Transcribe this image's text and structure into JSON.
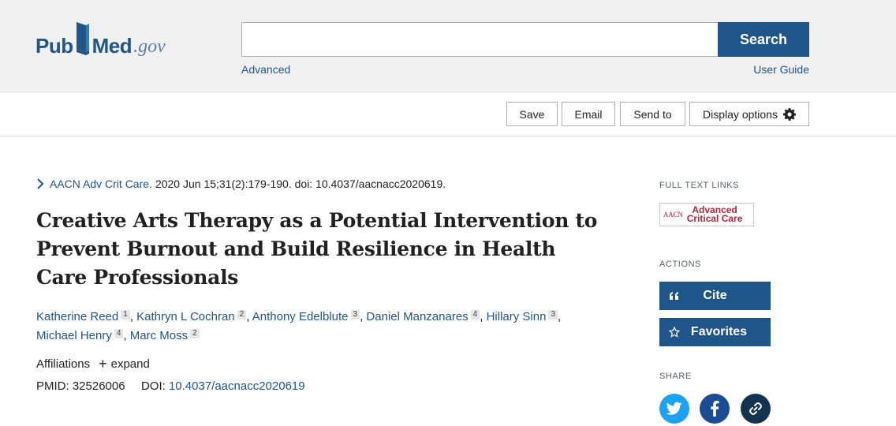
{
  "logo": {
    "pub": "Pub",
    "med": "Med",
    "gov": ".gov"
  },
  "search": {
    "value": "",
    "placeholder": "",
    "button_label": "Search",
    "advanced_label": "Advanced",
    "user_guide_label": "User Guide"
  },
  "toolbar": {
    "save_label": "Save",
    "email_label": "Email",
    "send_to_label": "Send to",
    "display_options_label": "Display options"
  },
  "article": {
    "journal": "AACN Adv Crit Care.",
    "citation_rest": "2020 Jun 15;31(2):179-190. doi: 10.4037/aacnacc2020619.",
    "title": "Creative Arts Therapy as a Potential Intervention to Prevent Burnout and Build Resilience in Health Care Professionals",
    "authors": [
      {
        "name": "Katherine Reed",
        "aff": "1"
      },
      {
        "name": "Kathryn L Cochran",
        "aff": "2"
      },
      {
        "name": "Anthony Edelblute",
        "aff": "3"
      },
      {
        "name": "Daniel Manzanares",
        "aff": "4"
      },
      {
        "name": "Hillary Sinn",
        "aff": "3"
      },
      {
        "name": "Michael Henry",
        "aff": "4"
      },
      {
        "name": "Marc Moss",
        "aff": "2"
      }
    ],
    "affiliations_label": "Affiliations",
    "expand_label": "expand",
    "pmid_label": "PMID:",
    "pmid": "32526006",
    "doi_label": "DOI:",
    "doi": "10.4037/aacnacc2020619"
  },
  "sidebar": {
    "full_text_links_heading": "FULL TEXT LINKS",
    "aacn_logo": {
      "small": "AACN",
      "line1": "Advanced",
      "line2": "Critical Care"
    },
    "actions_heading": "ACTIONS",
    "cite_label": "Cite",
    "favorites_label": "Favorites",
    "share_heading": "SHARE"
  },
  "icons": {
    "book": "book-icon",
    "gear": "gear-icon",
    "chevron": "chevron-right-icon",
    "quote": "quote-icon",
    "star": "star-icon",
    "twitter": "twitter-icon",
    "facebook": "facebook-icon",
    "link": "link-icon"
  },
  "colors": {
    "brand": "#20558a",
    "header_bg": "#f0f0f0",
    "twitter": "#1da1f2",
    "facebook": "#1a4b93",
    "permalink": "#13334e",
    "aacn_red": "#b0253a"
  }
}
